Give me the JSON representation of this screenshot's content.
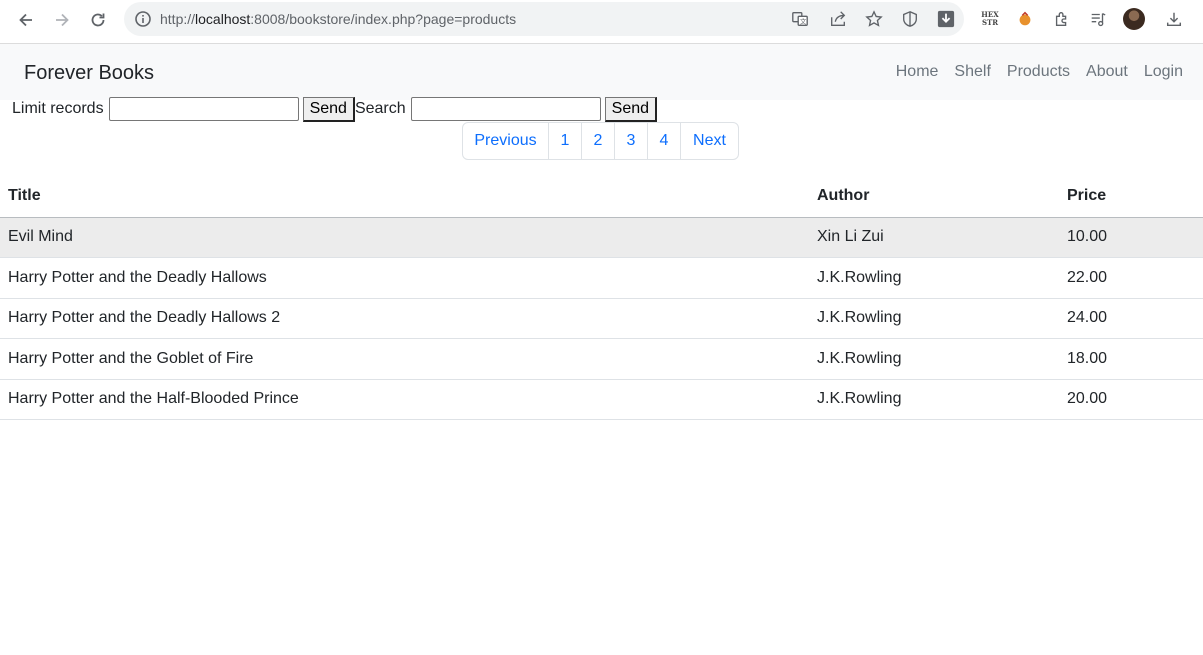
{
  "browser": {
    "url_prefix": "http://",
    "url_host": "localhost",
    "url_rest": ":8008/bookstore/index.php?page=products",
    "hex_top": "HEX",
    "hex_bottom": "STR"
  },
  "navbar": {
    "brand": "Forever Books",
    "links": [
      "Home",
      "Shelf",
      "Products",
      "About",
      "Login"
    ]
  },
  "forms": {
    "limit_label": "Limit records",
    "limit_value": "",
    "limit_send": "Send",
    "search_label": "Search",
    "search_value": "",
    "search_send": "Send"
  },
  "pagination": {
    "previous": "Previous",
    "pages": [
      "1",
      "2",
      "3",
      "4"
    ],
    "next": "Next"
  },
  "table": {
    "headers": [
      "Title",
      "Author",
      "Price"
    ],
    "rows": [
      [
        "Evil Mind",
        "Xin Li Zui",
        "10.00"
      ],
      [
        "Harry Potter and the Deadly Hallows",
        "J.K.Rowling",
        "22.00"
      ],
      [
        "Harry Potter and the Deadly Hallows 2",
        "J.K.Rowling",
        "24.00"
      ],
      [
        "Harry Potter and the Goblet of Fire",
        "J.K.Rowling",
        "18.00"
      ],
      [
        "Harry Potter and the Half-Blooded Prince",
        "J.K.Rowling",
        "20.00"
      ]
    ]
  },
  "colors": {
    "link": "#0d6efd",
    "navbar_bg": "#f8f9fa",
    "row_highlight": "#ececec"
  }
}
